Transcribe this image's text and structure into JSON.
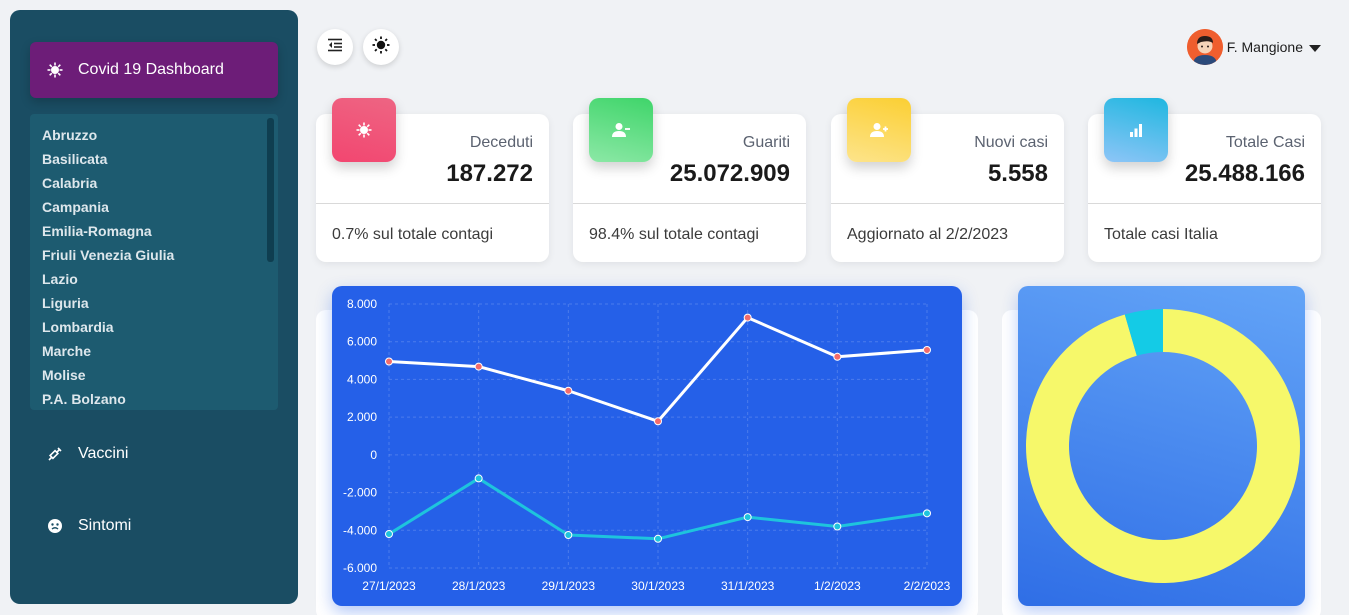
{
  "sidebar": {
    "brand_label": "Covid 19 Dashboard",
    "regions": [
      "Abruzzo",
      "Basilicata",
      "Calabria",
      "Campania",
      "Emilia-Romagna",
      "Friuli Venezia Giulia",
      "Lazio",
      "Liguria",
      "Lombardia",
      "Marche",
      "Molise",
      "P.A. Bolzano"
    ],
    "vaccini_label": "Vaccini",
    "sintomi_label": "Sintomi"
  },
  "header": {
    "user_name": "F. Mangione"
  },
  "cards": [
    {
      "label": "Deceduti",
      "value": "187.272",
      "footer": "0.7% sul totale contagi",
      "color_from": "#ee6583",
      "color_to": "#f24670"
    },
    {
      "label": "Guariti",
      "value": "25.072.909",
      "footer": "98.4% sul totale contagi",
      "color_from": "#3fd56a",
      "color_to": "#8ce8a6"
    },
    {
      "label": "Nuovi casi",
      "value": "5.558",
      "footer": "Aggiornato al 2/2/2023",
      "color_from": "#fbcf33",
      "color_to": "#fde48b"
    },
    {
      "label": "Totale Casi",
      "value": "25.488.166",
      "footer": "Totale casi Italia",
      "color_from": "#1fb7e0",
      "color_to": "#8ec5f7"
    }
  ],
  "chart_data": [
    {
      "type": "line",
      "x": [
        "27/1/2023",
        "28/1/2023",
        "29/1/2023",
        "30/1/2023",
        "31/1/2023",
        "1/2/2023",
        "2/2/2023"
      ],
      "y_ticks": [
        "8.000",
        "6.000",
        "4.000",
        "2.000",
        "0",
        "-2.000",
        "-4.000",
        "-6.000"
      ],
      "ylim": [
        -6000,
        8000
      ],
      "grid": true,
      "series": [
        {
          "values": [
            4950,
            4680,
            3400,
            1780,
            7280,
            5200,
            5560
          ],
          "color": "#ffffff",
          "point_color": "#f36b6b"
        },
        {
          "values": [
            -4200,
            -1250,
            -4250,
            -4450,
            -3300,
            -3800,
            -3100
          ],
          "color": "#1ec4dd",
          "point_color": "#1ec4dd"
        }
      ]
    },
    {
      "type": "pie",
      "values": [
        95.5,
        4.5
      ],
      "colors": [
        "#f6f86a",
        "#14cbe6"
      ]
    }
  ]
}
